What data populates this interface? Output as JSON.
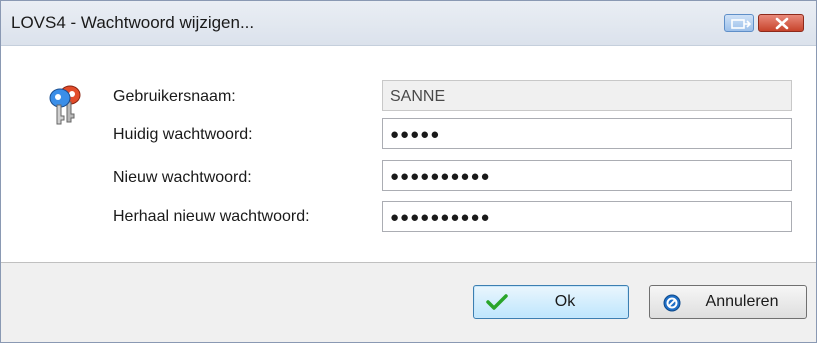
{
  "window": {
    "title": "LOVS4 - Wachtwoord wijzigen..."
  },
  "form": {
    "username_label": "Gebruikersnaam:",
    "username_value": "SANNE",
    "current_label": "Huidig wachtwoord:",
    "current_value": "●●●●●",
    "new_label": "Nieuw wachtwoord:",
    "new_value": "●●●●●●●●●●",
    "repeat_label": "Herhaal nieuw wachtwoord:",
    "repeat_value": "●●●●●●●●●●"
  },
  "buttons": {
    "ok_label": "Ok",
    "cancel_label": "Annuleren"
  },
  "icons": {
    "dialog_icon": "keys-icon",
    "ok_icon": "checkmark-icon",
    "cancel_icon": "no-entry-icon",
    "pin_icon": "pin-icon",
    "close_icon": "close-icon"
  },
  "colors": {
    "ok_check": "#2aa52a",
    "cancel_icon": "#1f6fc7",
    "close_button": "#c7442c"
  }
}
